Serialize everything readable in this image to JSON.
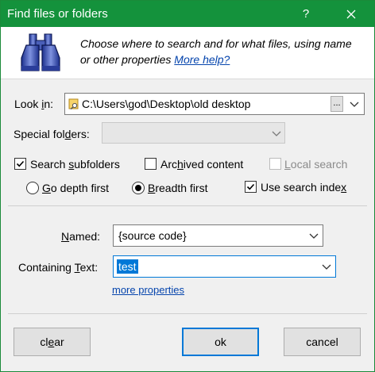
{
  "window": {
    "title": "Find files or folders",
    "help_label": "?",
    "close_label": "✕"
  },
  "header": {
    "description_line1": "Choose where to search and for what files, using name",
    "description_line2": "or other properties ",
    "help_link": "More help?"
  },
  "look_in": {
    "label_pre": "Look ",
    "label_key": "i",
    "label_post": "n:",
    "value": "C:\\Users\\god\\Desktop\\old desktop",
    "browse_label": "..."
  },
  "special_folders": {
    "label_pre": "Special fol",
    "label_key": "d",
    "label_post": "ers:",
    "value": ""
  },
  "options": {
    "search_subfolders": {
      "pre": "Search ",
      "key": "s",
      "post": "ubfolders",
      "checked": true
    },
    "archived_content": {
      "pre": "Arc",
      "key": "h",
      "post": "ived content",
      "checked": false
    },
    "local_search": {
      "pre": "",
      "key": "L",
      "post": "ocal search",
      "checked": false,
      "enabled": false
    },
    "go_depth_first": {
      "pre": "",
      "key": "G",
      "post": "o depth first",
      "selected": false
    },
    "breadth_first": {
      "pre": "",
      "key": "B",
      "post": "readth first",
      "selected": true
    },
    "use_search_index": {
      "pre": "Use search inde",
      "key": "x",
      "post": "",
      "checked": true
    }
  },
  "named": {
    "label_pre": "",
    "label_key": "N",
    "label_post": "amed:",
    "value": "{source code}"
  },
  "containing_text": {
    "label_pre": "Containing ",
    "label_key": "T",
    "label_post": "ext:",
    "value": "test"
  },
  "more_properties": "more properties",
  "buttons": {
    "clear": {
      "pre": "cl",
      "key": "e",
      "post": "ar"
    },
    "ok": "ok",
    "cancel": "cancel"
  },
  "colors": {
    "title_bar": "#14923c",
    "accent": "#0078d7",
    "link": "#0645ad"
  },
  "icons": {
    "logo": "binoculars-icon",
    "folder": "folder-search-icon",
    "dropdown": "chevron-down-icon",
    "close": "close-icon",
    "help": "help-icon"
  }
}
